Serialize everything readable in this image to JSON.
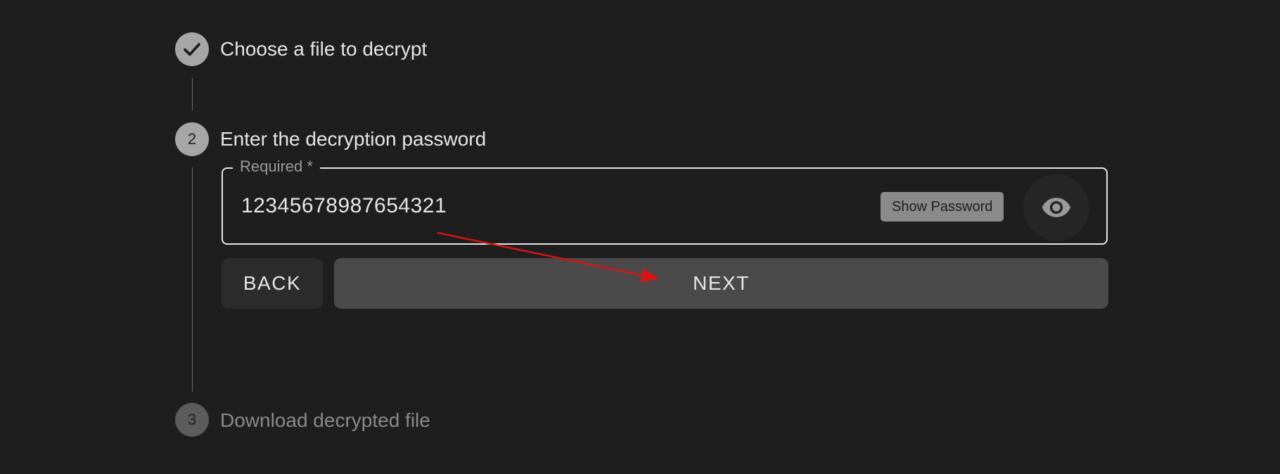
{
  "stepper": {
    "steps": [
      {
        "label": "Choose a file to decrypt",
        "state": "completed",
        "icon": "check-icon"
      },
      {
        "label": "Enter the decryption password",
        "number": "2",
        "state": "active"
      },
      {
        "label": "Download decrypted file",
        "number": "3",
        "state": "inactive"
      }
    ]
  },
  "password_field": {
    "label": "Required *",
    "value": "12345678987654321",
    "tooltip": "Show Password",
    "toggle_icon": "eye-icon"
  },
  "actions": {
    "back_label": "BACK",
    "next_label": "NEXT"
  },
  "colors": {
    "background": "#1e1e1e",
    "annotation_arrow": "#e01010"
  }
}
